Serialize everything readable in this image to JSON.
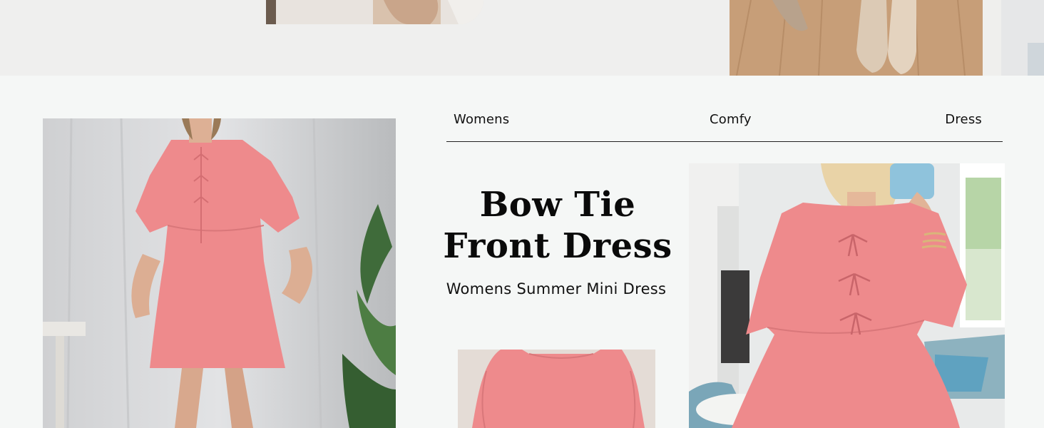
{
  "nav": {
    "tags": [
      "Womens",
      "Comfy",
      "Dress"
    ]
  },
  "product": {
    "title": "Bow Tie Front Dress",
    "subtitle": "Womens Summer Mini Dress"
  },
  "colors": {
    "dress": "#ee8a8c",
    "background": "#f5f7f6",
    "top_band": "#efefee",
    "rule": "#222222"
  }
}
